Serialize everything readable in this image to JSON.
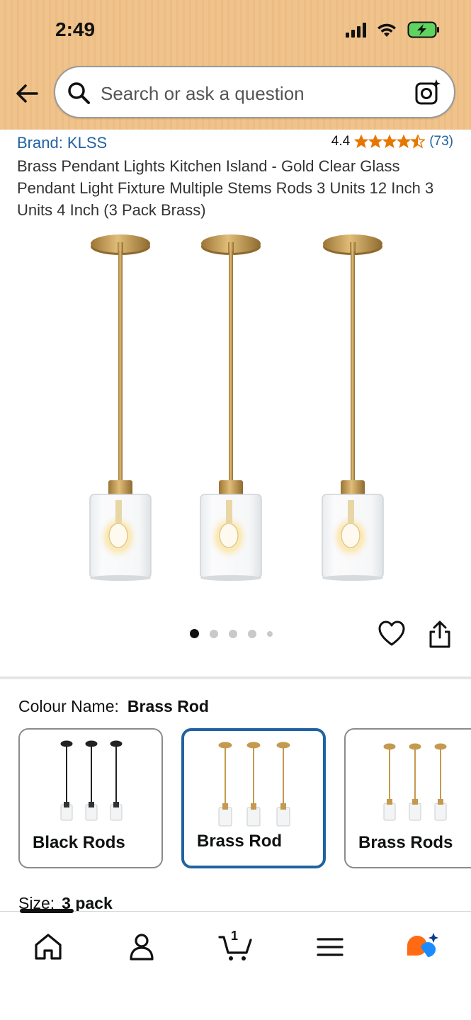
{
  "status_bar": {
    "time": "2:49"
  },
  "header": {
    "back_icon": "back-arrow-icon",
    "search": {
      "placeholder": "Search or ask a question",
      "camera_icon": "camera-lens-icon"
    },
    "background_color": "#f0c38c"
  },
  "product": {
    "brand": "Brand: KLSS",
    "rating": {
      "value": "4.4",
      "stars": 4.5,
      "count": "(73)",
      "star_color": "#e77600"
    },
    "title": "Brass Pendant Lights Kitchen Island - Gold Clear Glass Pendant Light Fixture Multiple Stems Rods 3 Units 12 Inch 3 Units 4 Inch (3 Pack Brass)",
    "image": {
      "active_index": 0,
      "dot_count": 5
    },
    "actions": {
      "wishlist_icon": "heart-icon",
      "share_icon": "share-icon"
    }
  },
  "variations": {
    "colour_label": "Colour Name:",
    "colour_value": "Brass Rod",
    "options": [
      {
        "label": "Black Rods",
        "selected": false
      },
      {
        "label": "Brass Rod",
        "selected": true
      },
      {
        "label": "Brass Rods",
        "selected": false
      }
    ],
    "size_label": "Size:",
    "size_value": "3 pack"
  },
  "bottom_nav": {
    "items": [
      "home-icon",
      "account-icon",
      "cart-icon",
      "menu-icon",
      "rufus-icon"
    ],
    "cart_count": "1"
  },
  "colors": {
    "link": "#2162a1",
    "selected_border": "#2162a1",
    "brass": "#c49a4f"
  }
}
